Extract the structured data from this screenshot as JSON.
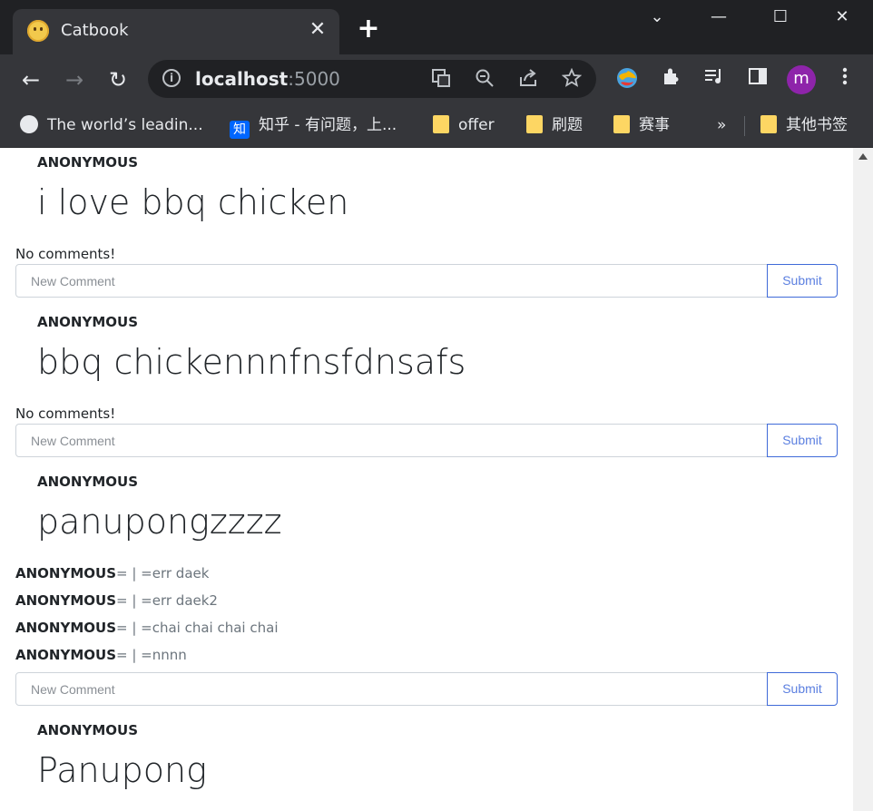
{
  "browser": {
    "tab": {
      "title": "Catbook",
      "close_glyph": "✕"
    },
    "new_tab_glyph": "+",
    "window_controls": {
      "tabsearch": "⌄",
      "minimize": "—",
      "maximize": "☐",
      "close": "✕"
    },
    "nav": {
      "back": "←",
      "forward": "→",
      "reload": "↻"
    },
    "omnibox": {
      "host": "localhost",
      "port": ":5000"
    },
    "profile_initial": "m",
    "bookmarks": [
      {
        "label": "The world’s leadin...",
        "icon": "github-icon"
      },
      {
        "label": "知乎 - 有问题，上...",
        "icon": "zhihu-icon",
        "icon_text": "知"
      },
      {
        "label": "offer",
        "icon": "folder-icon"
      },
      {
        "label": "刷题",
        "icon": "folder-icon"
      },
      {
        "label": "赛事",
        "icon": "folder-icon"
      },
      {
        "label": "»",
        "icon": ""
      },
      {
        "label": "其他书签",
        "icon": "folder-icon"
      }
    ]
  },
  "feed": {
    "stories": [
      {
        "author": "ANONYMOUS",
        "content": "i love bbq chicken",
        "no_comments": "No comments!",
        "comments": []
      },
      {
        "author": "ANONYMOUS",
        "content": "bbq chickennnfnsfdnsafs",
        "no_comments": "No comments!",
        "comments": []
      },
      {
        "author": "ANONYMOUS",
        "content": "panupongzzzz",
        "no_comments": "",
        "comments": [
          {
            "author": "ANONYMOUS",
            "text": "= | =err daek"
          },
          {
            "author": "ANONYMOUS",
            "text": "= | =err daek2"
          },
          {
            "author": "ANONYMOUS",
            "text": "= | =chai chai chai chai"
          },
          {
            "author": "ANONYMOUS",
            "text": "= | =nnnn"
          }
        ]
      },
      {
        "author": "ANONYMOUS",
        "content": "Panupong",
        "no_comments": "",
        "comments": []
      }
    ],
    "new_comment_placeholder": "New Comment",
    "submit_label": "Submit"
  },
  "colors": {
    "accent": "#3f6ad8",
    "chrome_dark": "#202124",
    "chrome_toolbar": "#35363a",
    "folder": "#fdd663"
  }
}
